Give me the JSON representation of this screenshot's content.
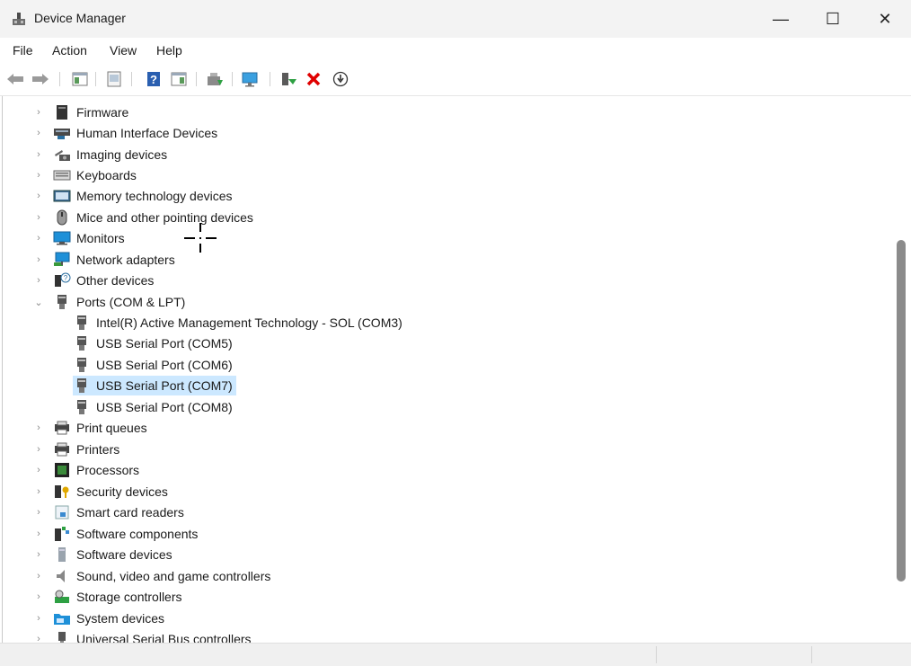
{
  "window": {
    "title": "Device Manager",
    "controls": {
      "minimize": "—",
      "maximize": "☐",
      "close": "✕"
    }
  },
  "menu": [
    "File",
    "Action",
    "View",
    "Help"
  ],
  "toolbar": {
    "buttons": [
      "back-icon",
      "forward-icon",
      "show-hide-console-tree-icon",
      "properties-icon",
      "help-icon",
      "show-action-pane-icon",
      "update-driver-icon",
      "scan-hardware-icon",
      "enable-device-icon",
      "uninstall-device-icon",
      "download-icon"
    ]
  },
  "tree": {
    "top_items": [
      {
        "label": "Firmware",
        "icon": "firmware-icon"
      },
      {
        "label": "Human Interface Devices",
        "icon": "hid-icon"
      },
      {
        "label": "Imaging devices",
        "icon": "camera-icon"
      },
      {
        "label": "Keyboards",
        "icon": "keyboard-icon"
      },
      {
        "label": "Memory technology devices",
        "icon": "memory-icon"
      },
      {
        "label": "Mice and other pointing devices",
        "icon": "mouse-icon"
      },
      {
        "label": "Monitors",
        "icon": "monitor-icon"
      },
      {
        "label": "Network adapters",
        "icon": "network-icon"
      },
      {
        "label": "Other devices",
        "icon": "unknown-device-icon"
      }
    ],
    "expanded": {
      "label": "Ports (COM & LPT)",
      "icon": "port-icon",
      "children": [
        "Intel(R) Active Management Technology - SOL (COM3)",
        "USB Serial Port (COM5)",
        "USB Serial Port (COM6)",
        "USB Serial Port (COM7)",
        "USB Serial Port (COM8)"
      ],
      "selected_child": "USB Serial Port (COM7)"
    },
    "bottom_items": [
      {
        "label": "Print queues",
        "icon": "printer-icon"
      },
      {
        "label": "Printers",
        "icon": "printer-icon"
      },
      {
        "label": "Processors",
        "icon": "processor-icon"
      },
      {
        "label": "Security devices",
        "icon": "security-icon"
      },
      {
        "label": "Smart card readers",
        "icon": "smartcard-icon"
      },
      {
        "label": "Software components",
        "icon": "software-component-icon"
      },
      {
        "label": "Software devices",
        "icon": "software-device-icon"
      },
      {
        "label": "Sound, video and game controllers",
        "icon": "speaker-icon"
      },
      {
        "label": "Storage controllers",
        "icon": "storage-icon"
      },
      {
        "label": "System devices",
        "icon": "system-folder-icon"
      },
      {
        "label": "Universal Serial Bus controllers",
        "icon": "usb-icon"
      }
    ]
  },
  "colors": {
    "selection": "#cce8ff",
    "monitor_blue": "#1e90d8",
    "uninstall_red": "#e00000"
  }
}
